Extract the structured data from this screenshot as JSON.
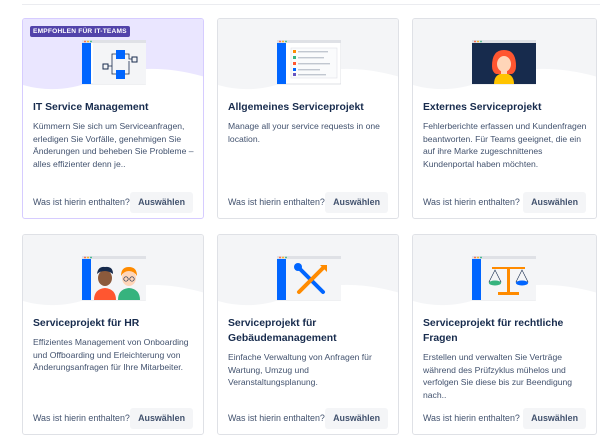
{
  "templates": [
    {
      "title": "IT Service Management",
      "description": "Kümmern Sie sich um Serviceanfragen, erledigen Sie Vorfälle, genehmigen Sie Änderungen und beheben Sie Probleme – alles effizienter denn je..",
      "badge": "EMPFOHLEN FÜR IT-TEAMS",
      "illustration": "it-service-workflow-illustration",
      "banner_color": "#eae6ff"
    },
    {
      "title": "Allgemeines Serviceprojekt",
      "description": "Manage all your service requests in one location.",
      "illustration": "request-list-illustration",
      "banner_color": "#f4f5f7"
    },
    {
      "title": "Externes Serviceprojekt",
      "description": "Fehlerberichte erfassen und Kundenfragen beantworten. Für Teams geeignet, die ein auf ihre Marke zugeschnittenes Kundenportal haben möchten.",
      "illustration": "customer-portal-illustration",
      "banner_color": "#f4f5f7"
    },
    {
      "title": "Serviceprojekt für HR",
      "description": "Effizientes Management von Onboarding und Offboarding und Erleichterung von Änderungsanfragen für Ihre Mitarbeiter.",
      "illustration": "hr-people-illustration",
      "banner_color": "#f4f5f7"
    },
    {
      "title": "Serviceprojekt für Gebäudemanagement",
      "description": "Einfache Verwaltung von Anfragen für Wartung, Umzug und Veranstaltungsplanung.",
      "illustration": "tools-illustration",
      "banner_color": "#f4f5f7"
    },
    {
      "title": "Serviceprojekt für rechtliche Fragen",
      "description": "Erstellen und verwalten Sie Verträge während des Prüfzyklus mühelos und verfolgen Sie diese bis zur Beendigung nach..",
      "illustration": "legal-scales-illustration",
      "banner_color": "#f4f5f7"
    }
  ],
  "labels": {
    "whats_inside": "Was ist hierin enthalten?",
    "select": "Auswählen"
  },
  "colors": {
    "brand_blue": "#0065ff",
    "badge_purple": "#5243aa",
    "text_dark": "#172b4d",
    "text_muted": "#42526e"
  }
}
